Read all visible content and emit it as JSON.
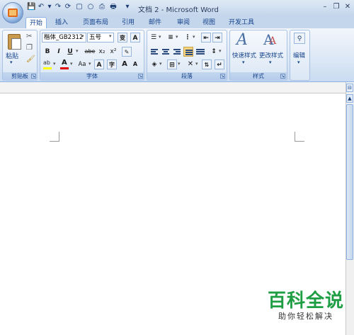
{
  "window": {
    "title": "文档 2 - Microsoft Word",
    "controls": {
      "minimize": "–",
      "restore": "❐",
      "close": "✕"
    }
  },
  "qat": {
    "save": "💾",
    "undo": "↶",
    "redo": "↷",
    "more": "▾"
  },
  "tabs": [
    {
      "label": "开始",
      "active": true
    },
    {
      "label": "插入"
    },
    {
      "label": "页面布局"
    },
    {
      "label": "引用"
    },
    {
      "label": "邮件"
    },
    {
      "label": "审阅"
    },
    {
      "label": "视图"
    },
    {
      "label": "开发工具"
    }
  ],
  "clipboard": {
    "paste_label": "粘贴",
    "group_label": "剪贴板"
  },
  "font": {
    "name": "楷体_GB2312",
    "size": "五号",
    "group_label": "字体",
    "bold": "B",
    "italic": "I",
    "underline": "U",
    "strike": "abe",
    "subscript": "x₂",
    "superscript": "x²",
    "change_case": "Aa",
    "grow": "A",
    "shrink": "A"
  },
  "paragraph": {
    "group_label": "段落"
  },
  "styles": {
    "quick_styles": "快速样式",
    "change_styles": "更改样式",
    "group_label": "样式"
  },
  "editing": {
    "label": "编辑"
  },
  "watermark": {
    "main": "百科全说",
    "sub": "助你轻松解决"
  },
  "colors": {
    "accent": "#15428b",
    "highlight": "#ffff00",
    "font_color": "#e00000",
    "watermark": "#1f9e44"
  }
}
